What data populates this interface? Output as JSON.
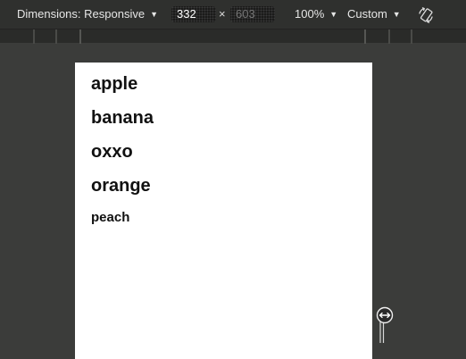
{
  "toolbar": {
    "dimensions_label": "Dimensions: Responsive",
    "width_value": "332",
    "height_placeholder": "603",
    "times_symbol": "×",
    "zoom_label": "100%",
    "throttle_label": "Custom",
    "caret_glyph": "▼"
  },
  "page": {
    "items": [
      "apple",
      "banana",
      "oxxo",
      "orange",
      "peach"
    ]
  },
  "icons": {
    "rotate": "rotate-icon",
    "resize": "resize-handle-icon"
  },
  "colors": {
    "toolbar_bg": "#2f302e",
    "canvas_bg": "#3b3c3a",
    "page_bg": "#ffffff",
    "text": "#111111"
  }
}
